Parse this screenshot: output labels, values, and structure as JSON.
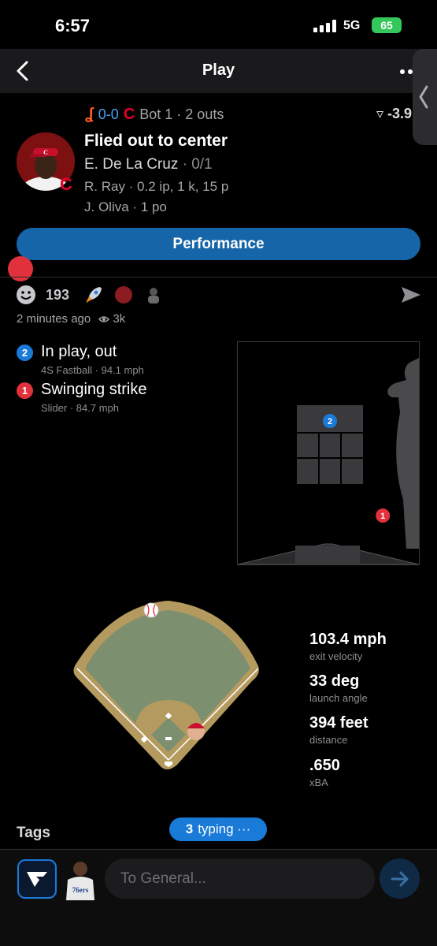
{
  "status": {
    "time": "6:57",
    "network": "5G",
    "battery": "65"
  },
  "nav": {
    "title": "Play"
  },
  "game": {
    "score": "0-0",
    "inning": "Bot 1 · 2 outs",
    "win_prob": "-3.9"
  },
  "play": {
    "title": "Flied out to center",
    "batter_name": "E. De La Cruz",
    "batter_line": "· 0/1",
    "pitcher_line": "R. Ray · 0.2 ip, 1 k, 15 p",
    "fielder_line": "J. Oliva · 1 po"
  },
  "performance_button": "Performance",
  "reactions": {
    "count": "193"
  },
  "meta": {
    "time_ago": "2 minutes ago",
    "views": "3k"
  },
  "pitches": [
    {
      "num": "2",
      "result": "In play, out",
      "detail": "4S Fastball ·  94.1 mph",
      "color": "#1a7ad8",
      "zone_x": 0.5,
      "zone_y": 0.2
    },
    {
      "num": "1",
      "result": "Swinging strike",
      "detail": "Slider ·  84.7 mph",
      "color": "#e0313c",
      "zone_x": 1.3,
      "zone_y": 1.4
    }
  ],
  "stats": [
    {
      "value": "103.4 mph",
      "label": "exit velocity"
    },
    {
      "value": "33 deg",
      "label": "launch angle"
    },
    {
      "value": "394 feet",
      "label": "distance"
    },
    {
      "value": ".650",
      "label": "xBA"
    }
  ],
  "tags_label": "Tags",
  "typing": {
    "count": "3",
    "label": "typing ···"
  },
  "composer": {
    "placeholder": "To General..."
  }
}
